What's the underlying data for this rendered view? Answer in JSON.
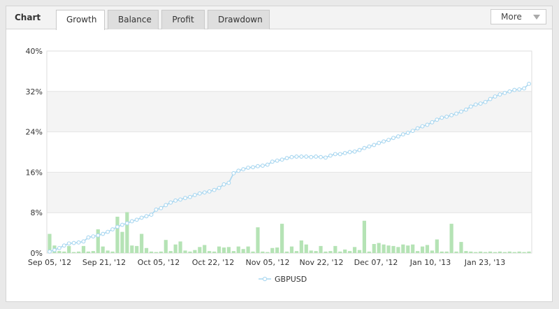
{
  "header": {
    "label": "Chart",
    "more_label": "More",
    "tabs": [
      {
        "label": "Growth",
        "active": true
      },
      {
        "label": "Balance",
        "active": false
      },
      {
        "label": "Profit",
        "active": false
      },
      {
        "label": "Drawdown",
        "active": false
      }
    ]
  },
  "colors": {
    "line": "#a9d7f0",
    "bar": "#b5e3b5",
    "band": "#f4f4f4",
    "grid": "#e4e4e4"
  },
  "chart_data": {
    "type": "line",
    "ylim": [
      0,
      40
    ],
    "y_ticks": [
      0,
      8,
      16,
      24,
      32,
      40
    ],
    "y_tick_labels": [
      "0%",
      "8%",
      "16%",
      "24%",
      "32%",
      "40%"
    ],
    "x_tick_labels": [
      "Sep 05, '12",
      "Sep 21, '12",
      "Oct 05, '12",
      "Oct 22, '12",
      "Nov 05, '12",
      "Nov 22, '12",
      "Dec 07, '12",
      "Jan 10, '13",
      "Jan 23, '13"
    ],
    "legend": "bottom-center",
    "grid": true,
    "series": [
      {
        "name": "GBPUSD",
        "type": "line",
        "values": [
          0.3,
          0.6,
          1.0,
          1.5,
          1.9,
          2.0,
          2.1,
          2.3,
          3.1,
          3.3,
          3.5,
          3.8,
          4.2,
          4.7,
          5.2,
          5.6,
          5.9,
          6.3,
          6.6,
          7.0,
          7.3,
          7.6,
          8.6,
          8.9,
          9.5,
          10.0,
          10.4,
          10.6,
          10.9,
          11.1,
          11.5,
          11.8,
          12.0,
          12.2,
          12.5,
          12.9,
          13.6,
          13.9,
          15.8,
          16.3,
          16.6,
          16.9,
          17.0,
          17.2,
          17.3,
          17.5,
          18.1,
          18.3,
          18.5,
          18.8,
          19.0,
          19.1,
          19.1,
          19.1,
          19.0,
          19.1,
          19.0,
          18.9,
          19.3,
          19.6,
          19.6,
          19.8,
          20.0,
          20.1,
          20.4,
          20.8,
          21.1,
          21.4,
          21.8,
          22.1,
          22.4,
          22.8,
          23.1,
          23.5,
          23.8,
          24.2,
          24.7,
          25.1,
          25.4,
          25.9,
          26.4,
          26.8,
          27.0,
          27.3,
          27.6,
          28.0,
          28.4,
          29.0,
          29.4,
          29.6,
          29.9,
          30.5,
          31.0,
          31.4,
          31.7,
          32.0,
          32.3,
          32.4,
          32.6,
          33.5
        ]
      },
      {
        "type": "bar",
        "values": [
          3.8,
          1.5,
          0.4,
          0.3,
          1.4,
          0.2,
          0.3,
          1.4,
          0.3,
          0.4,
          4.7,
          1.3,
          0.5,
          0.3,
          7.2,
          4.2,
          8.1,
          1.5,
          1.4,
          3.8,
          1.0,
          0.3,
          0.2,
          0.3,
          2.6,
          0.4,
          1.7,
          2.3,
          0.5,
          0.3,
          0.6,
          1.2,
          1.6,
          0.4,
          0.3,
          1.3,
          1.1,
          1.2,
          0.4,
          1.3,
          0.8,
          1.3,
          0.3,
          5.1,
          0.3,
          0.2,
          1.0,
          1.1,
          5.8,
          0.3,
          1.3,
          0.4,
          2.5,
          1.7,
          0.5,
          0.4,
          1.4,
          0.3,
          0.4,
          1.4,
          0.3,
          0.7,
          0.4,
          1.2,
          0.6,
          6.4,
          0.3,
          1.8,
          2.0,
          1.7,
          1.5,
          1.4,
          1.2,
          1.7,
          1.5,
          1.7,
          0.4,
          1.3,
          1.6,
          0.5,
          2.7,
          0.3,
          0.3,
          5.8,
          0.3,
          2.2,
          0.4,
          0.3,
          0.2,
          0.3,
          0.2,
          0.3,
          0.2,
          0.3,
          0.2,
          0.3,
          0.2,
          0.3,
          0.2,
          0.3
        ]
      }
    ]
  }
}
